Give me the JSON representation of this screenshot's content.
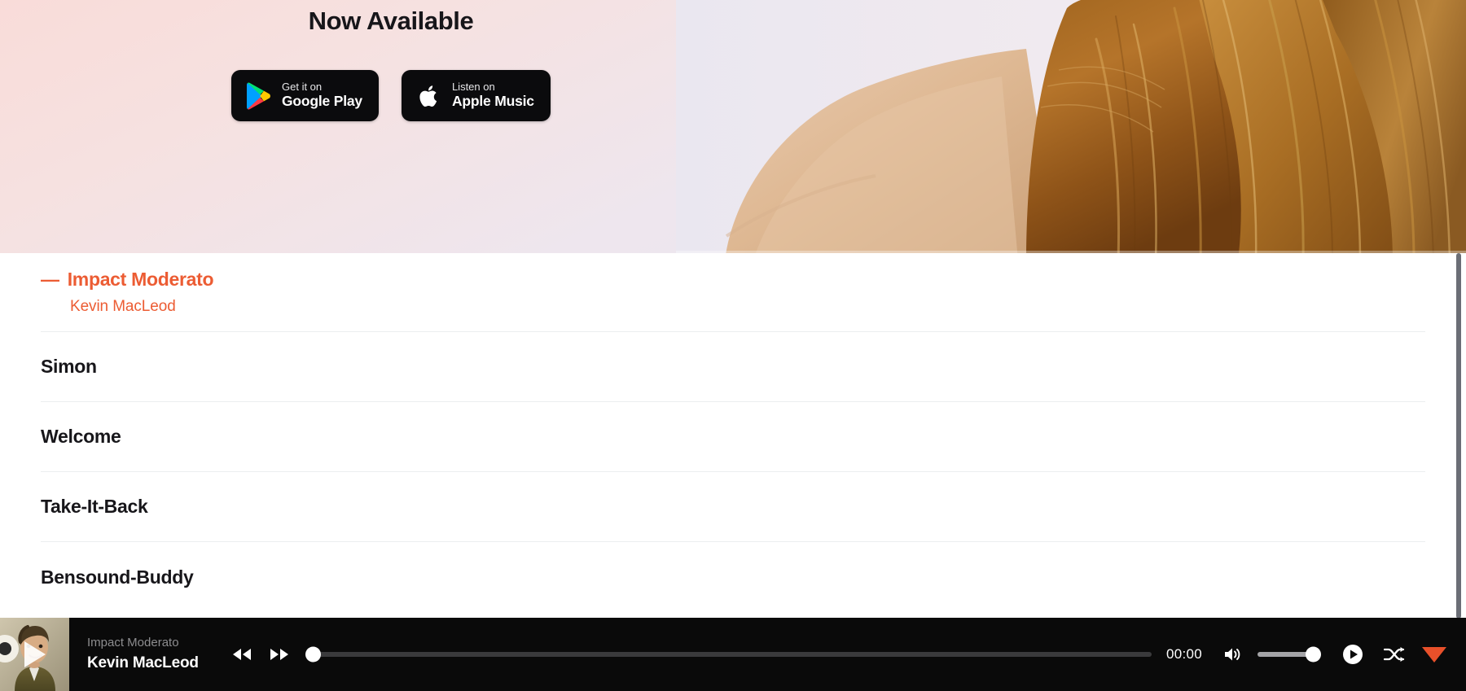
{
  "hero": {
    "title": "Now Available",
    "badges": [
      {
        "icon": "google-play-icon",
        "small": "Get it on",
        "big": "Google Play"
      },
      {
        "icon": "apple-icon",
        "small": "Listen on",
        "big": "Apple Music"
      }
    ],
    "photo_alt": "woman-with-long-auburn-hair-photo"
  },
  "tracklist": [
    {
      "dash": "—",
      "title": "Impact Moderato",
      "artist": "Kevin MacLeod",
      "active": true
    },
    {
      "dash": "",
      "title": "Simon",
      "artist": "",
      "active": false
    },
    {
      "dash": "",
      "title": "Welcome",
      "artist": "",
      "active": false
    },
    {
      "dash": "",
      "title": "Take-It-Back",
      "artist": "",
      "active": false
    },
    {
      "dash": "",
      "title": "Bensound-Buddy",
      "artist": "",
      "active": false
    }
  ],
  "player": {
    "thumb_alt": "man-in-olive-jacket-video-thumbnail",
    "now_playing_title": "Impact Moderato",
    "now_playing_artist": "Kevin MacLeod",
    "rewind_label": "rewind",
    "forward_label": "fast-forward",
    "progress_percent": 0,
    "current_time": "00:00",
    "volume_percent": 100,
    "play_label": "play",
    "shuffle_label": "shuffle",
    "collapse_label": "collapse"
  },
  "colors": {
    "accent": "#ec5c33",
    "triangle": "#e8502a",
    "player_bg": "#0a0a0a",
    "hero_gradient_start": "#f9dcd9",
    "hero_gradient_end": "#e9e6ef",
    "divider": "#eceef0",
    "scrollbar": "#6b6e76"
  },
  "scrollbar": {
    "name": "page-scrollbar"
  }
}
